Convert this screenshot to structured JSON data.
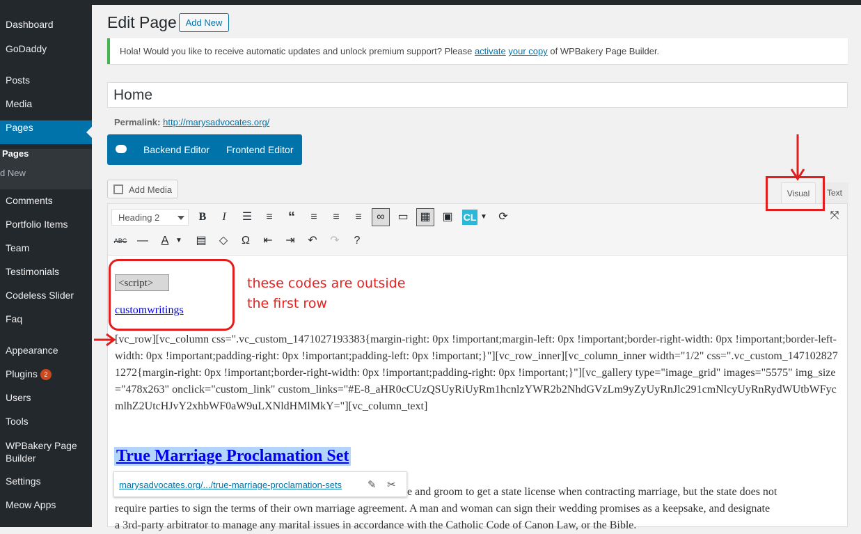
{
  "sidebar": {
    "items": [
      {
        "label": "Dashboard"
      },
      {
        "label": "GoDaddy"
      },
      {
        "label": "Posts"
      },
      {
        "label": "Media"
      },
      {
        "label": "Pages"
      },
      {
        "label": "Comments"
      },
      {
        "label": "Portfolio Items"
      },
      {
        "label": "Team"
      },
      {
        "label": "Testimonials"
      },
      {
        "label": "Codeless Slider"
      },
      {
        "label": "Faq"
      },
      {
        "label": "Appearance"
      },
      {
        "label": "Plugins",
        "badge": "2"
      },
      {
        "label": "Users"
      },
      {
        "label": "Tools"
      },
      {
        "label": "WPBakery Page Builder"
      },
      {
        "label": "Settings"
      },
      {
        "label": "Meow Apps"
      }
    ],
    "submenu": [
      "Pages",
      "d New"
    ]
  },
  "header": {
    "title": "Edit Page",
    "add_new": "Add New"
  },
  "notice": {
    "text_before": "Hola! Would you like to receive automatic updates and unlock premium support? Please ",
    "link1": "activate",
    "link2": "your copy",
    "text_after": " of WPBakery Page Builder."
  },
  "post": {
    "title": "Home",
    "permalink_label": "Permalink:",
    "permalink_url": "http://marysadvocates.org/"
  },
  "builder": {
    "backend": "Backend Editor",
    "frontend": "Frontend Editor"
  },
  "editor_toolbar": {
    "add_media": "Add Media",
    "tab_visual": "Visual",
    "tab_text": "Text",
    "format_select": "Heading 2"
  },
  "content": {
    "image_alt": "<script>",
    "link_text": "customwritings",
    "shortcode": "[vc_row][vc_column css=\".vc_custom_1471027193383{margin-right: 0px !important;margin-left: 0px !important;border-right-width: 0px !important;border-left-width: 0px !important;padding-right: 0px !important;padding-left: 0px !important;}\"][vc_row_inner][vc_column_inner width=\"1/2\" css=\".vc_custom_1471028271272{margin-right: 0px !important;border-right-width: 0px !important;padding-right: 0px !important;}\"][vc_gallery type=\"image_grid\" images=\"5575\" img_size=\"478x263\" onclick=\"custom_link\" custom_links=\"#E-8_aHR0cCUzQSUyRiUyRm1hcnlzYWR2b2NhdGVzLm9yZyUyRnJlc291cmNlcyUyRnRydWUtbWFycmlhZ2UtcHJvY2xhbWF0aW9uLXNldHMlMkY=\"][vc_column_text]",
    "heading": "True Marriage Proclamation Set",
    "paragraph_line1": "de and groom to get a state license when contracting marriage, but the state does not",
    "paragraph_line2": "require parties to sign the terms of their own marriage agreement. A man and woman can sign their wedding promises as a keepsake, and designate",
    "paragraph_line3": "a 3rd-party arbitrator to manage any marital issues in accordance with the Catholic Code of Canon Law, or the Bible."
  },
  "link_tooltip": {
    "url": "marysadvocates.org/.../true-marriage-proclamation-sets"
  },
  "annotation": {
    "line1": "these codes are outside",
    "line2": "the first row"
  },
  "colors": {
    "accent": "#0073aa",
    "annotation": "#e01e1e",
    "sidebar": "#23282d"
  }
}
